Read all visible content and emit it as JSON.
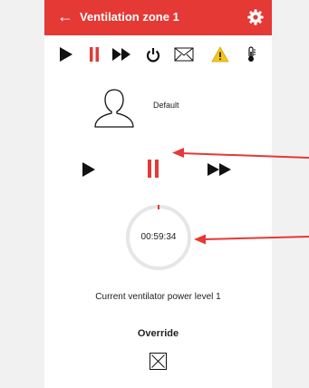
{
  "header": {
    "title": "Ventilation zone 1",
    "back_icon": "arrow-left-icon",
    "settings_icon": "gear-icon",
    "background": "#e53935"
  },
  "toolbar": {
    "items": [
      {
        "icon": "play-icon"
      },
      {
        "icon": "pause-icon",
        "active": true
      },
      {
        "icon": "fast-forward-icon"
      },
      {
        "icon": "power-icon"
      },
      {
        "icon": "mail-icon"
      },
      {
        "icon": "warning-icon"
      },
      {
        "icon": "thermometer-icon"
      }
    ]
  },
  "profile": {
    "icon": "user-icon",
    "label": "Default"
  },
  "controls": {
    "play_icon": "play-icon",
    "pause_icon": "pause-icon",
    "fast_forward_icon": "fast-forward-icon"
  },
  "timer": {
    "value": "00:59:34",
    "progress": 0.01
  },
  "status_text": "Current ventilator power level 1",
  "override": {
    "label": "Override",
    "checked": true
  },
  "colors": {
    "accent": "#e53935",
    "icon": "#111111",
    "warning": "#f5c518",
    "ring": "#e6e6e6"
  }
}
